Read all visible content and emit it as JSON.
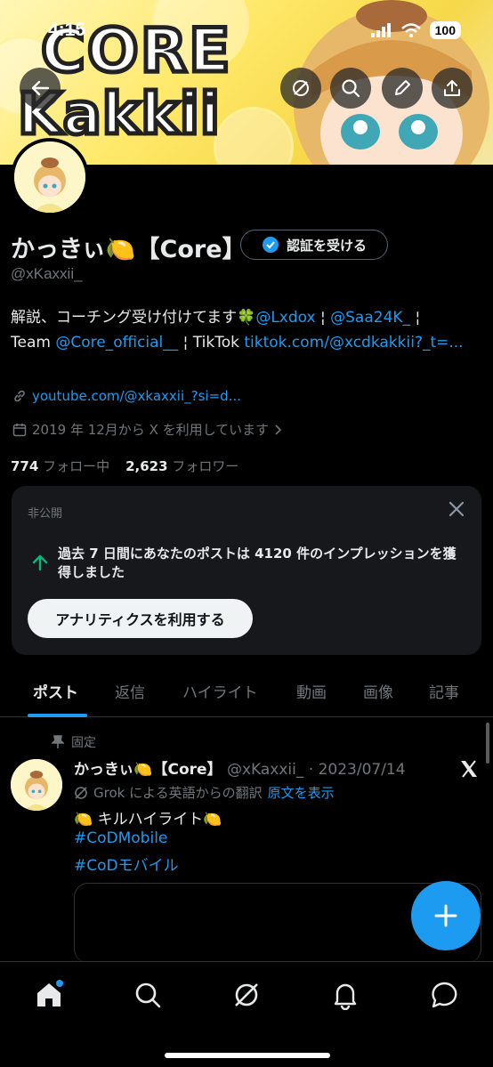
{
  "status_bar": {
    "time": "4:15",
    "battery": "100"
  },
  "banner": {
    "line1": "CORE",
    "line2": "Kakkii"
  },
  "profile": {
    "name": "かっきぃ🍋【Core】",
    "verify_button": "認証を受ける",
    "handle": "@xKaxxii_",
    "bio_text1": "解説、コーチング受け付けてます🍀",
    "bio_link1": "@Lxdox",
    "bio_sep": " ¦ ",
    "bio_link2": "@Saa24K_",
    "bio_team": "Team ",
    "bio_link3": "@Core_official__",
    "bio_tiktok": " ¦ TikTok ",
    "bio_link4": "tiktok.com/@xcdkakkii?_t=...",
    "website": "youtube.com/@xkaxxii_?si=d...",
    "joined": "2019 年 12月から X を利用しています",
    "following_count": "774",
    "following_label": "フォロー中",
    "followers_count": "2,623",
    "followers_label": "フォロワー"
  },
  "analytics_card": {
    "private_label": "非公開",
    "message": "過去 7 日間にあなたのポストは 4120 件のインプレッションを獲得しました",
    "button": "アナリティクスを利用する"
  },
  "tabs": [
    "ポスト",
    "返信",
    "ハイライト",
    "動画",
    "画像",
    "記事"
  ],
  "post": {
    "pinned_label": "固定",
    "author": "かっきぃ🍋【Core】",
    "handle_date": "@xKaxxii_ · 2023/07/14",
    "translation_note": "Grok による英語からの翻訳",
    "show_original": "原文を表示",
    "text": "🍋 キルハイライト🍋",
    "hashtag1": "#CoDMobile",
    "hashtag2": "#CoDモバイル"
  },
  "colors": {
    "accent": "#1d9bf0",
    "background": "#000000",
    "muted": "#71767b"
  }
}
